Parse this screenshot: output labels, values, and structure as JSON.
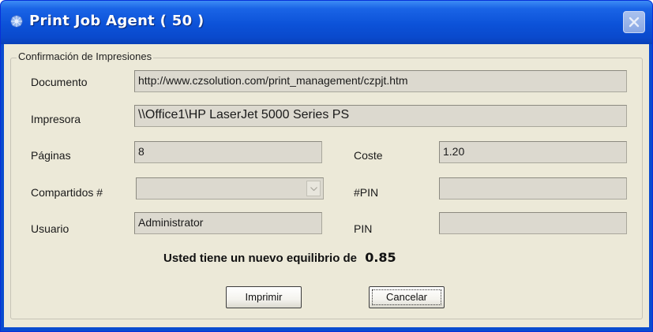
{
  "window": {
    "title": "Print Job Agent ( 50 )",
    "icon": "printer-agent-icon",
    "close_icon": "close-icon"
  },
  "group": {
    "legend": "Confirmación de Impresiones"
  },
  "form": {
    "documento": {
      "label": "Documento",
      "value": "http://www.czsolution.com/print_management/czpjt.htm"
    },
    "impresora": {
      "label": "Impresora",
      "value": "\\\\Office1\\HP LaserJet 5000 Series PS"
    },
    "paginas": {
      "label": "Páginas",
      "value": "8"
    },
    "coste": {
      "label": "Coste",
      "value": "1.20"
    },
    "compartidos": {
      "label": "Compartidos #",
      "value": ""
    },
    "pin_num": {
      "label": "#PIN",
      "value": ""
    },
    "usuario": {
      "label": "Usuario",
      "value": "Administrator"
    },
    "pin": {
      "label": "PIN",
      "value": ""
    }
  },
  "balance": {
    "text": "Usted tiene un nuevo equilibrio de",
    "amount": "0.85"
  },
  "buttons": {
    "print": "Imprimir",
    "cancel": "Cancelar"
  },
  "colors": {
    "titlebar": "#0c52d8",
    "client_bg": "#ece9d8",
    "field_bg": "#dcd9cf"
  }
}
